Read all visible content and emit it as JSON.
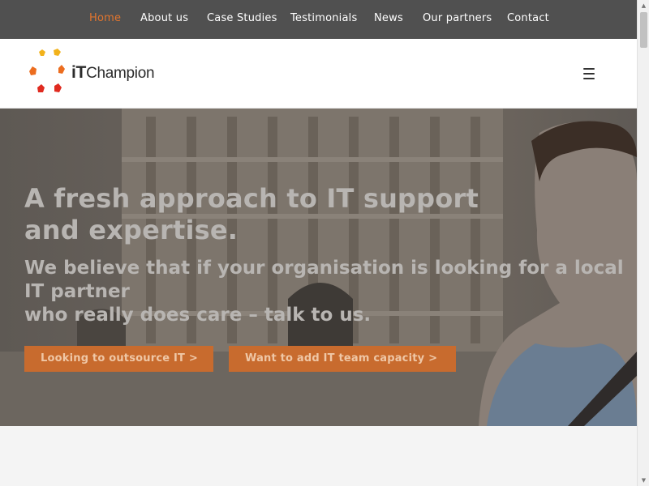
{
  "nav": {
    "items": [
      {
        "label": "Home",
        "active": true
      },
      {
        "label": "About us"
      },
      {
        "label": "Case Studies"
      },
      {
        "label": "Testimonials"
      },
      {
        "label": "News"
      },
      {
        "label": "Our partners"
      },
      {
        "label": "Contact"
      }
    ]
  },
  "header": {
    "logo_it": "iT",
    "logo_rest": "Champion",
    "menu_icon": "hamburger-icon"
  },
  "hero": {
    "title": "A fresh approach to IT support and expertise.",
    "subtitle_line1": "We believe that if your organisation is looking for a local IT partner",
    "subtitle_line2": "who really does care – talk to us.",
    "cta_outsource": "Looking to outsource IT >",
    "cta_capacity": "Want to add IT team capacity >"
  },
  "colors": {
    "accent": "#e2752e",
    "nav_bg": "#505050",
    "cta_bg": "#c86b2e"
  }
}
